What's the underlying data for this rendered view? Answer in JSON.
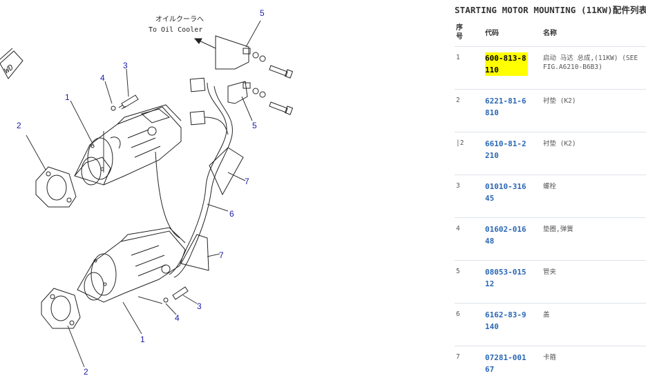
{
  "diagram": {
    "oil_cooler_jp": "オイルクーラへ",
    "oil_cooler_en": "To Oil Cooler",
    "brand_fragment": "WD",
    "callouts": [
      "1",
      "2",
      "3",
      "4",
      "5",
      "5",
      "6",
      "7",
      "7",
      "3",
      "4",
      "1",
      "2"
    ]
  },
  "panel": {
    "title": "STARTING MOTOR MOUNTING (11KW)配件列表",
    "headers": {
      "seq": "序号",
      "code": "代码",
      "name": "名称"
    },
    "rows": [
      {
        "seq": "1",
        "code": "600-813-8110",
        "name": "启动 马达 总成,(11KW) (SEE FIG.A6210-B6B3)",
        "highlight": true
      },
      {
        "seq": "2",
        "code": "6221-81-6810",
        "name": "衬垫 (K2)"
      },
      {
        "seq": "|2",
        "code": "6610-81-2210",
        "name": "衬垫 (K2)"
      },
      {
        "seq": "3",
        "code": "01010-31645",
        "name": "螺栓"
      },
      {
        "seq": "4",
        "code": "01602-01648",
        "name": "垫圈,弹簧"
      },
      {
        "seq": "5",
        "code": "08053-01512",
        "name": "管夹"
      },
      {
        "seq": "6",
        "code": "6162-83-9140",
        "name": "盖"
      },
      {
        "seq": "7",
        "code": "07281-00167",
        "name": "卡箍"
      }
    ]
  },
  "colors": {
    "link": "#2a67b5",
    "highlight": "#ffff00",
    "callout": "#1a1aa6"
  }
}
